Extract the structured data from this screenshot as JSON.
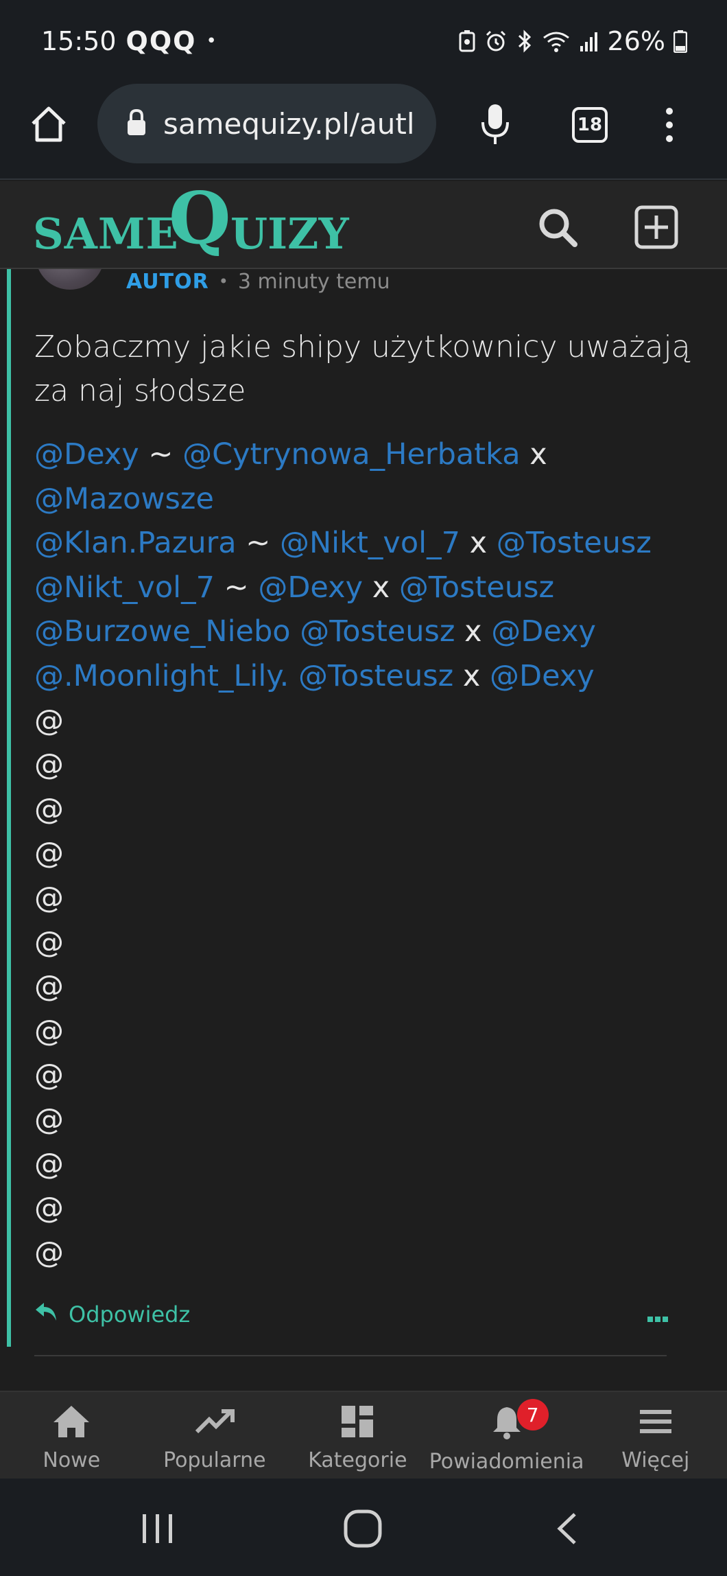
{
  "status_bar": {
    "time": "15:50",
    "notification_icons": "QQQ",
    "dot": "•",
    "battery": "26%",
    "icons": [
      "lock-battery-icon",
      "alarm-icon",
      "bluetooth-icon",
      "wifi-icon",
      "signal-icon",
      "battery-icon"
    ]
  },
  "browser": {
    "url": "samequizy.pl/autl",
    "tabs_count": "18"
  },
  "site": {
    "logo_same": "SAME",
    "logo_q": "Q",
    "logo_uizy": "UIZY"
  },
  "comment": {
    "author_label": "AUTOR",
    "separator": "•",
    "time": "3 minuty temu",
    "text": "Zobaczmy jakie shipy użytkownicy uważają za naj słodsze",
    "lines": [
      [
        {
          "t": "@Dexy",
          "m": true
        },
        {
          "t": " ~ ",
          "m": false
        },
        {
          "t": "@Cytrynowa_Herbatka",
          "m": true
        },
        {
          "t": " x",
          "m": false
        }
      ],
      [
        {
          "t": "@Mazowsze",
          "m": true
        }
      ],
      [
        {
          "t": "@Klan.Pazura",
          "m": true
        },
        {
          "t": " ~ ",
          "m": false
        },
        {
          "t": "@Nikt_vol_7",
          "m": true
        },
        {
          "t": " x ",
          "m": false
        },
        {
          "t": "@Tosteusz",
          "m": true
        }
      ],
      [
        {
          "t": "@Nikt_vol_7",
          "m": true
        },
        {
          "t": " ~ ",
          "m": false
        },
        {
          "t": "@Dexy",
          "m": true
        },
        {
          "t": " x ",
          "m": false
        },
        {
          "t": "@Tosteusz",
          "m": true
        }
      ],
      [
        {
          "t": "@Burzowe_Niebo",
          "m": true
        },
        {
          "t": " ",
          "m": false
        },
        {
          "t": "@Tosteusz",
          "m": true
        },
        {
          "t": " x ",
          "m": false
        },
        {
          "t": "@Dexy",
          "m": true
        }
      ],
      [
        {
          "t": "@.Moonlight_Lily.",
          "m": true
        },
        {
          "t": " ",
          "m": false
        },
        {
          "t": "@Tosteusz",
          "m": true
        },
        {
          "t": " x ",
          "m": false
        },
        {
          "t": "@Dexy",
          "m": true
        }
      ],
      [
        {
          "t": "@",
          "m": false
        }
      ],
      [
        {
          "t": "@",
          "m": false
        }
      ],
      [
        {
          "t": "@",
          "m": false
        }
      ],
      [
        {
          "t": "@",
          "m": false
        }
      ],
      [
        {
          "t": "@",
          "m": false
        }
      ],
      [
        {
          "t": "@",
          "m": false
        }
      ],
      [
        {
          "t": "@",
          "m": false
        }
      ],
      [
        {
          "t": "@",
          "m": false
        }
      ],
      [
        {
          "t": "@",
          "m": false
        }
      ],
      [
        {
          "t": "@",
          "m": false
        }
      ],
      [
        {
          "t": "@",
          "m": false
        }
      ],
      [
        {
          "t": "@",
          "m": false
        }
      ],
      [
        {
          "t": "@",
          "m": false
        }
      ]
    ],
    "reply_label": "Odpowiedz"
  },
  "bottom_nav": {
    "items": [
      {
        "label": "Nowe",
        "icon": "home-icon"
      },
      {
        "label": "Popularne",
        "icon": "trending-icon"
      },
      {
        "label": "Kategorie",
        "icon": "grid-icon"
      },
      {
        "label": "Powiadomienia",
        "icon": "bell-icon"
      },
      {
        "label": "Więcej",
        "icon": "hamburger-icon"
      }
    ],
    "notification_badge": "7"
  },
  "colors": {
    "accent": "#3ec1a6",
    "author": "#2f9ee6",
    "mention": "#2c7ac4",
    "badge": "#e0202a"
  }
}
